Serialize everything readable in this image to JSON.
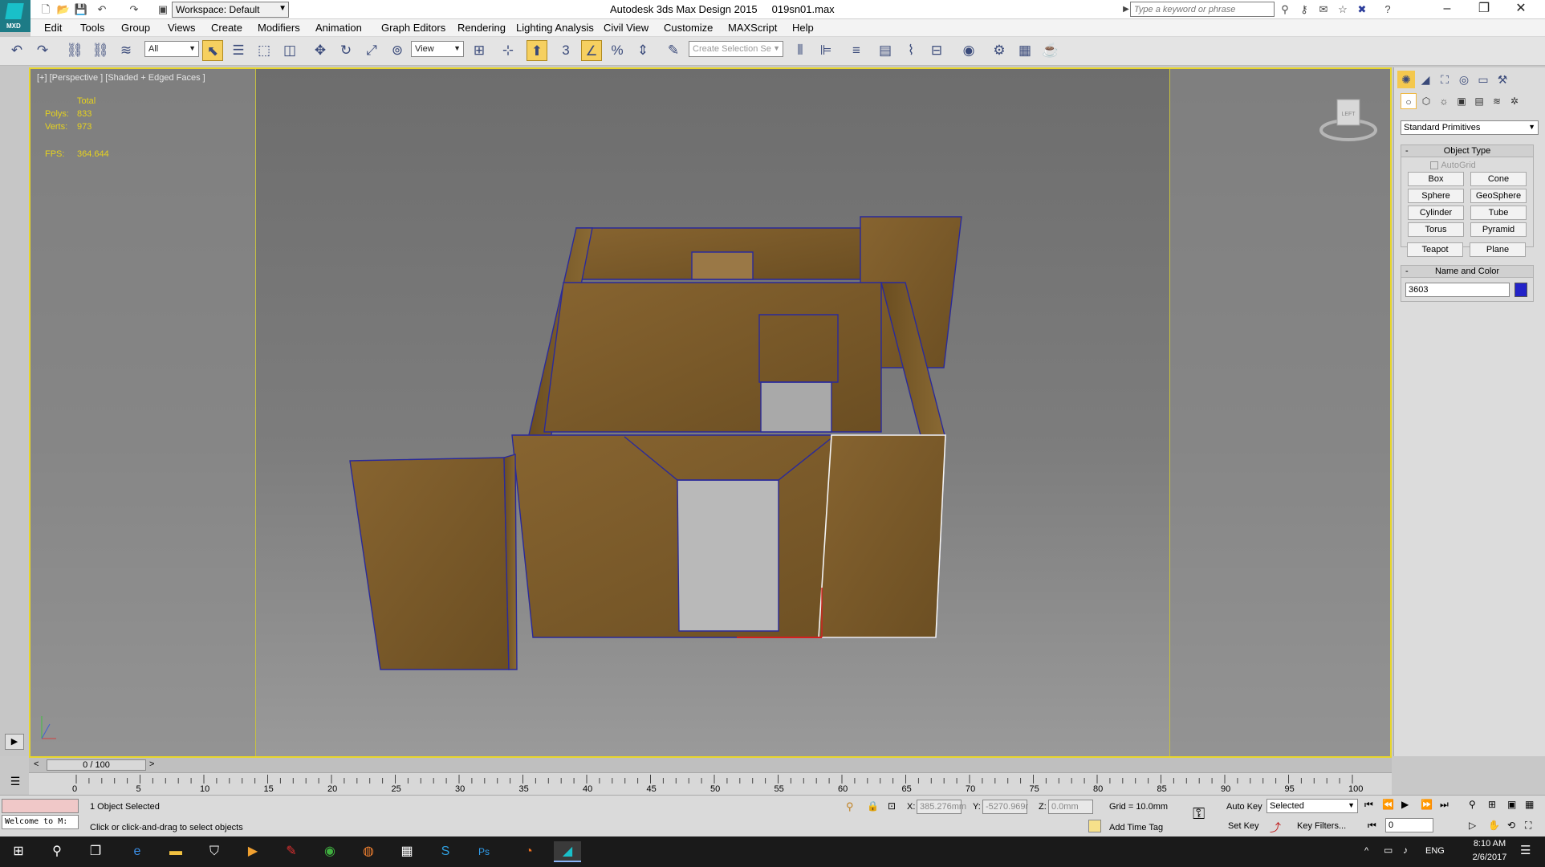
{
  "title_bar": {
    "app_title": "Autodesk 3ds Max Design 2015",
    "file_name": "019sn01.max",
    "workspace_label": "Workspace: Default",
    "search_placeholder": "Type a keyword or phrase"
  },
  "logo": {
    "label": "MXD"
  },
  "menu": {
    "items": [
      "Edit",
      "Tools",
      "Group",
      "Views",
      "Create",
      "Modifiers",
      "Animation",
      "Graph Editors",
      "Rendering",
      "Lighting Analysis",
      "Civil View",
      "Customize",
      "MAXScript",
      "Help"
    ]
  },
  "toolbar": {
    "selection_filter": "All",
    "ref_coord": "View",
    "snap_label": "3",
    "named_selection_placeholder": "Create Selection Se",
    "percent_symbol": "%"
  },
  "viewport": {
    "label": "[+] [Perspective ] [Shaded + Edged Faces ]",
    "stats": {
      "total_label": "Total",
      "polys_label": "Polys:",
      "polys_value": "833",
      "verts_label": "Verts:",
      "verts_value": "973",
      "fps_label": "FPS:",
      "fps_value": "364.644"
    },
    "viewcube_label": "LEFT",
    "colors": {
      "frame": "#e8d62c",
      "wall": "#7a5a26",
      "edge": "#2a2a9a"
    }
  },
  "command_panel": {
    "category": "Standard Primitives",
    "object_type": {
      "title": "Object Type",
      "autogrid": "AutoGrid",
      "buttons": [
        "Box",
        "Cone",
        "Sphere",
        "GeoSphere",
        "Cylinder",
        "Tube",
        "Torus",
        "Pyramid",
        "Teapot",
        "Plane"
      ]
    },
    "name_and_color": {
      "title": "Name and Color",
      "name_value": "3603",
      "color": "#2323c8"
    }
  },
  "time_slider": {
    "frame": "0 / 100",
    "prev": "<",
    "next": ">"
  },
  "trackbar": {
    "ticks": [
      "0",
      "5",
      "10",
      "15",
      "20",
      "25",
      "30",
      "35",
      "40",
      "45",
      "50",
      "55",
      "60",
      "65",
      "70",
      "75",
      "80",
      "85",
      "90",
      "95",
      "100"
    ]
  },
  "status": {
    "maxscript_text": "Welcome to M:",
    "selection_info": "1 Object Selected",
    "prompt": "Click or click-and-drag to select objects",
    "x_label": "X:",
    "x_value": "385.276mm",
    "y_label": "Y:",
    "y_value": "-5270.969r",
    "z_label": "Z:",
    "z_value": "0.0mm",
    "grid": "Grid = 10.0mm",
    "add_time_tag": "Add Time Tag",
    "auto_key": "Auto Key",
    "set_key": "Set Key",
    "key_mode": "Selected",
    "key_filters": "Key Filters...",
    "frame_field": "0"
  },
  "taskbar": {
    "language": "ENG",
    "time": "8:10 AM",
    "date": "2/6/2017"
  }
}
